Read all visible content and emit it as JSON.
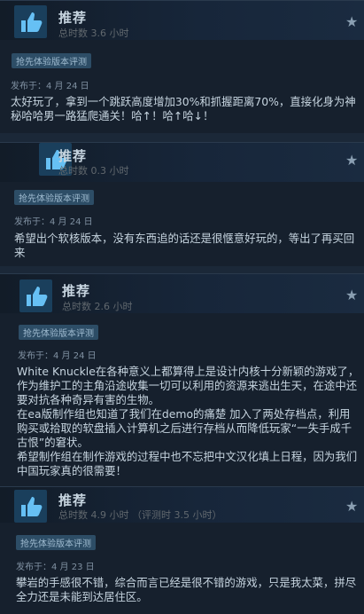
{
  "reviews": [
    {
      "verdict": "推荐",
      "hours": "总时数 3.6 小时",
      "badge": "抢先体验版本评测",
      "posted": "发布于：4 月 24 日",
      "paragraphs": [
        "太好玩了，拿到一个跳跃高度增加30%和抓握距离70%，直接化身为神秘哈哈男一路猛爬通关！哈↑！哈↑哈↓！"
      ]
    },
    {
      "verdict": "推荐",
      "hours": "总时数 0.3 小时",
      "badge": "抢先体验版本评测",
      "posted": "发布于：4 月 24 日",
      "paragraphs": [
        "希望出个软核版本，没有东西追的话还是很惬意好玩的，等出了再买回来"
      ]
    },
    {
      "verdict": "推荐",
      "hours": "总时数 2.6 小时",
      "badge": "抢先体验版本评测",
      "posted": "发布于：4 月 24 日",
      "paragraphs": [
        "White Knuckle在各种意义上都算得上是设计内核十分新颖的游戏了，作为维护工的主角沿途收集一切可以利用的资源来逃出生天，在途中还要对抗各种奇异有害的生物。",
        "在ea版制作组也知道了我们在demo的痛楚 加入了两处存档点，利用购买或拾取的软盘插入计算机之后进行存档从而降低玩家“一失手成千古恨”的窘状。",
        "希望制作组在制作游戏的过程中也不忘把中文汉化填上日程，因为我们中国玩家真的很需要！"
      ]
    },
    {
      "verdict": "推荐",
      "hours": "总时数 4.9 小时  （评测时 3.5 小时）",
      "badge": "抢先体验版本评测",
      "posted": "发布于：4 月 23 日",
      "paragraphs": [
        "攀岩的手感很不错，综合而言已经是很不错的游戏，只是我太菜，拼尽全力还是未能到达居住区。"
      ]
    }
  ]
}
